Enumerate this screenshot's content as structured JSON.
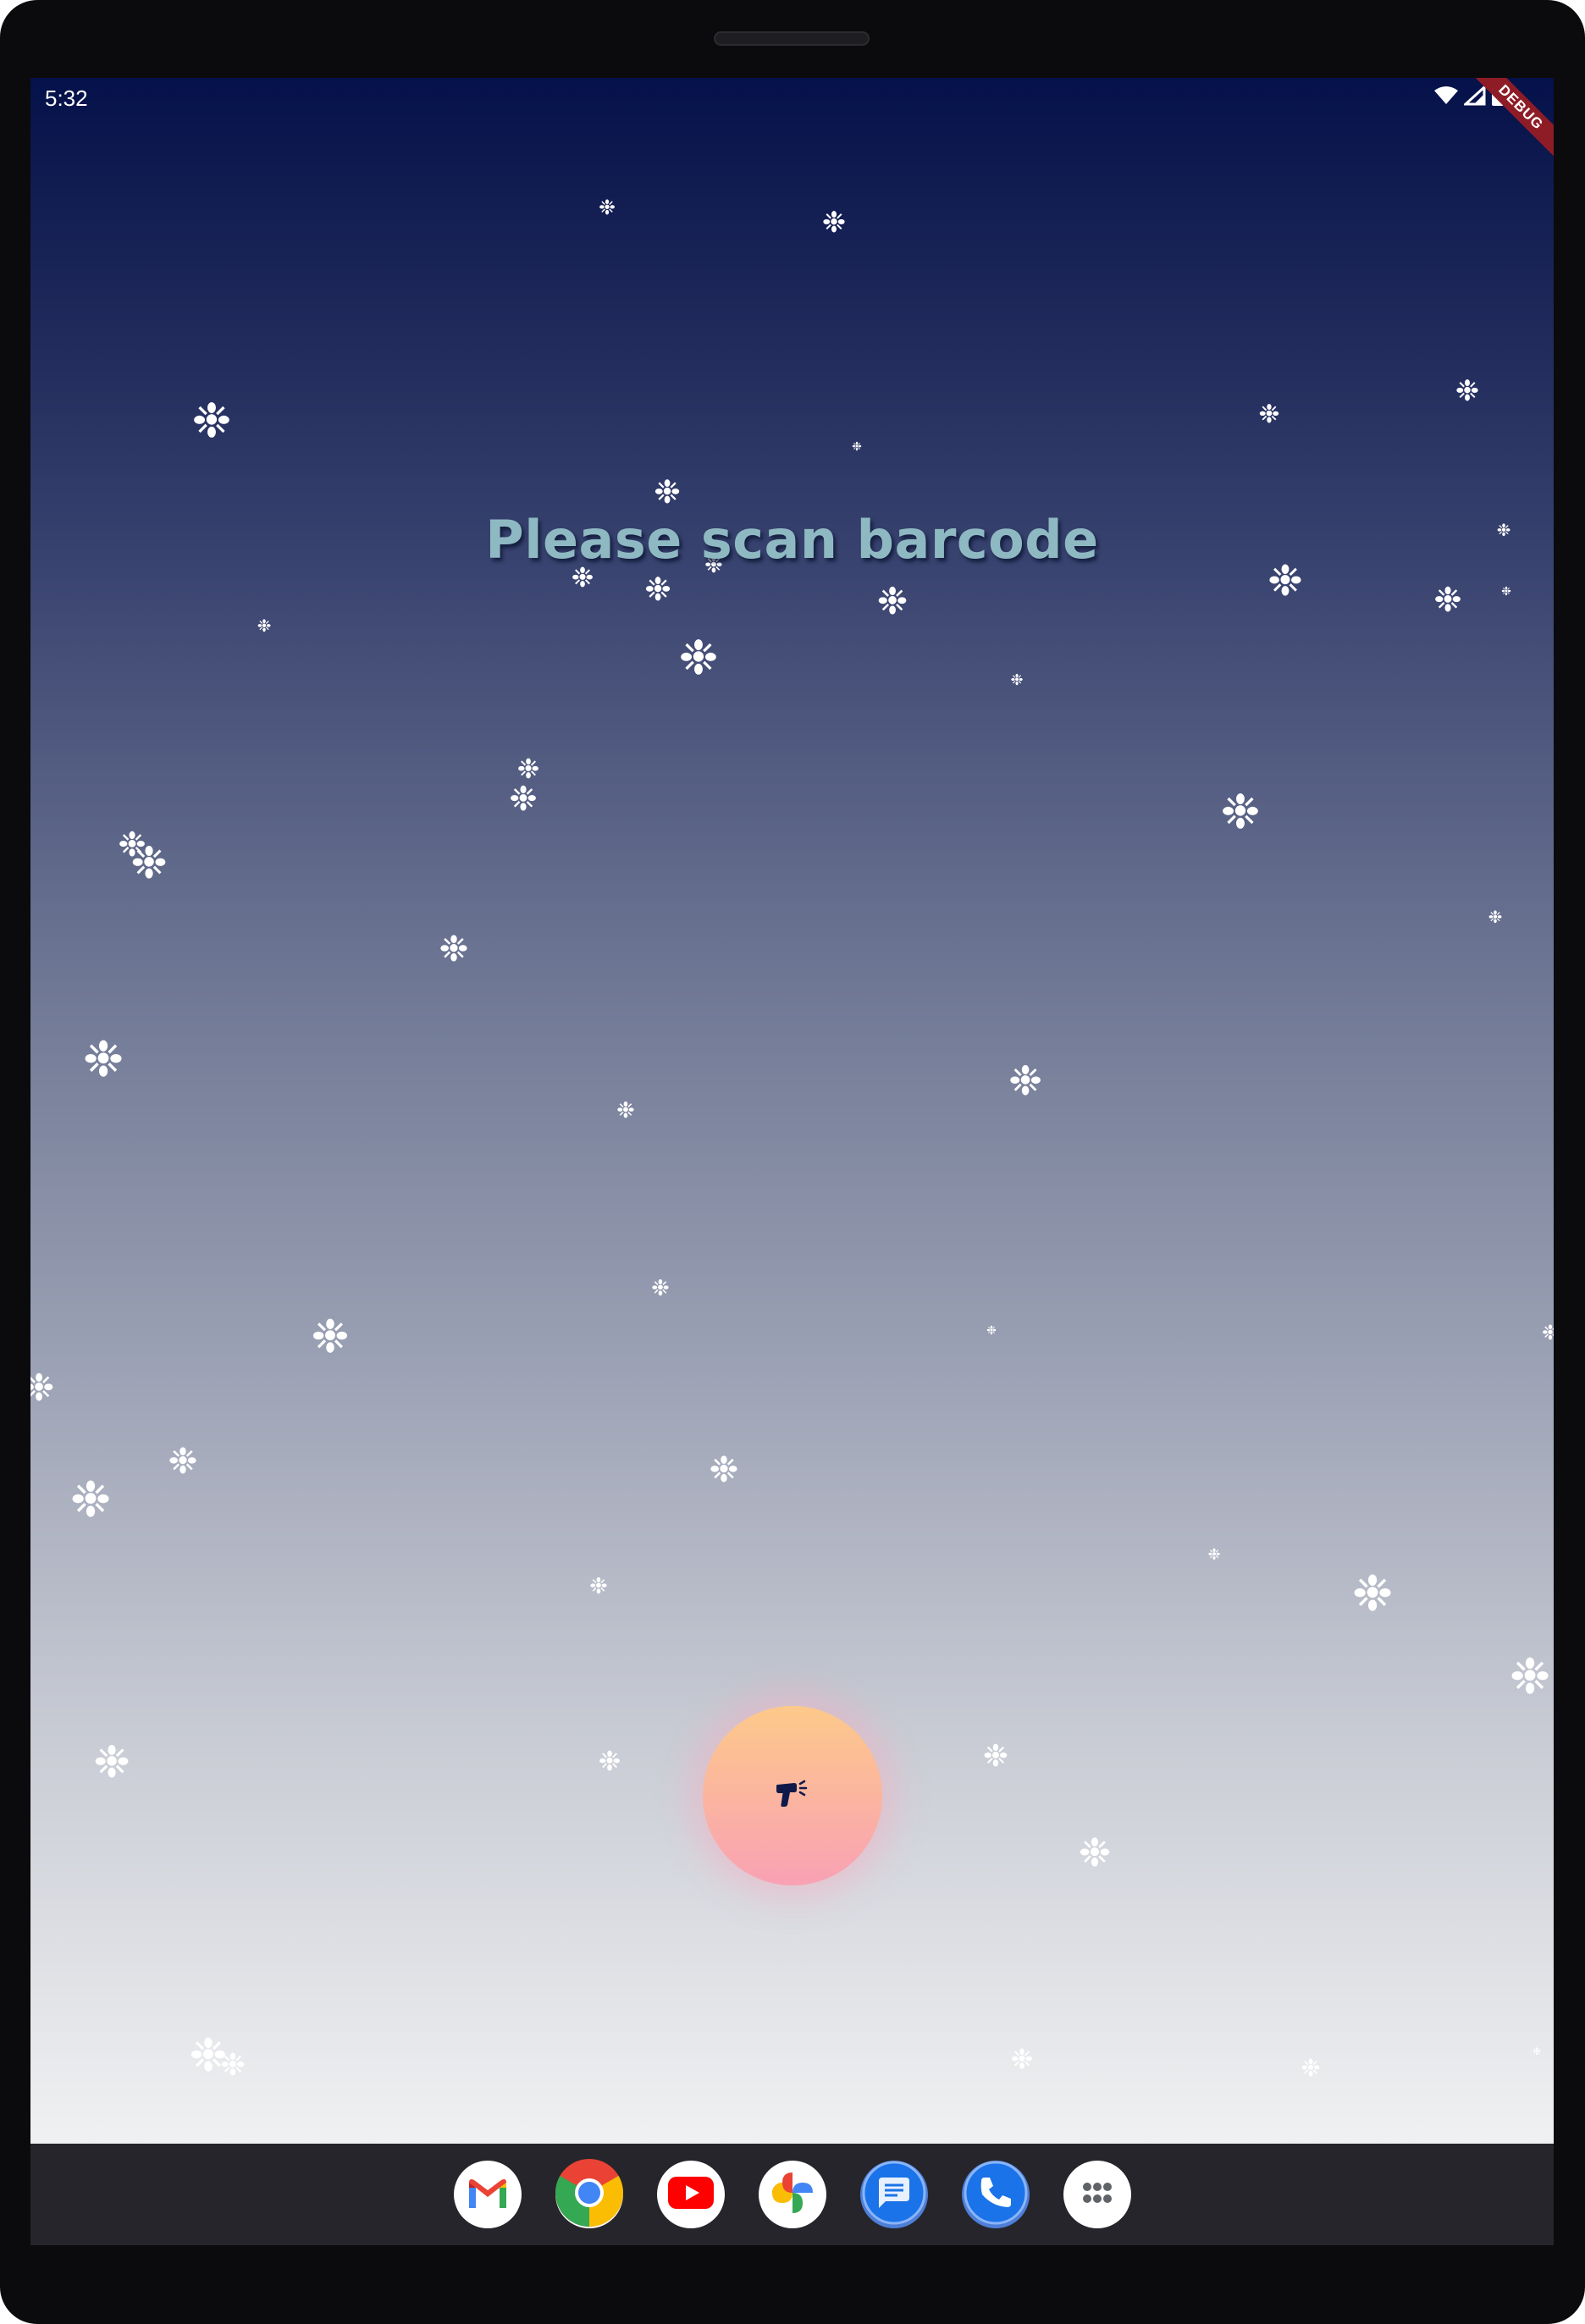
{
  "status_bar": {
    "time": "5:32",
    "icons": [
      "wifi-icon",
      "signal-icon",
      "battery-icon"
    ],
    "debug_banner": "DEBUG"
  },
  "main": {
    "title": "Please scan barcode",
    "scan_button_icon": "barcode-scanner-icon"
  },
  "dock": {
    "apps": [
      "gmail-icon",
      "chrome-icon",
      "youtube-icon",
      "photos-icon",
      "messages-icon",
      "phone-icon",
      "app-drawer-icon"
    ]
  },
  "theme": {
    "gradient_top": "#05114a",
    "gradient_bottom": "#f0f1f2",
    "title_color": "#8fb9c2",
    "button_gradient_top": "#fdc98a",
    "button_gradient_bottom": "#f9a1b4",
    "nav_bar": "#25252b"
  }
}
